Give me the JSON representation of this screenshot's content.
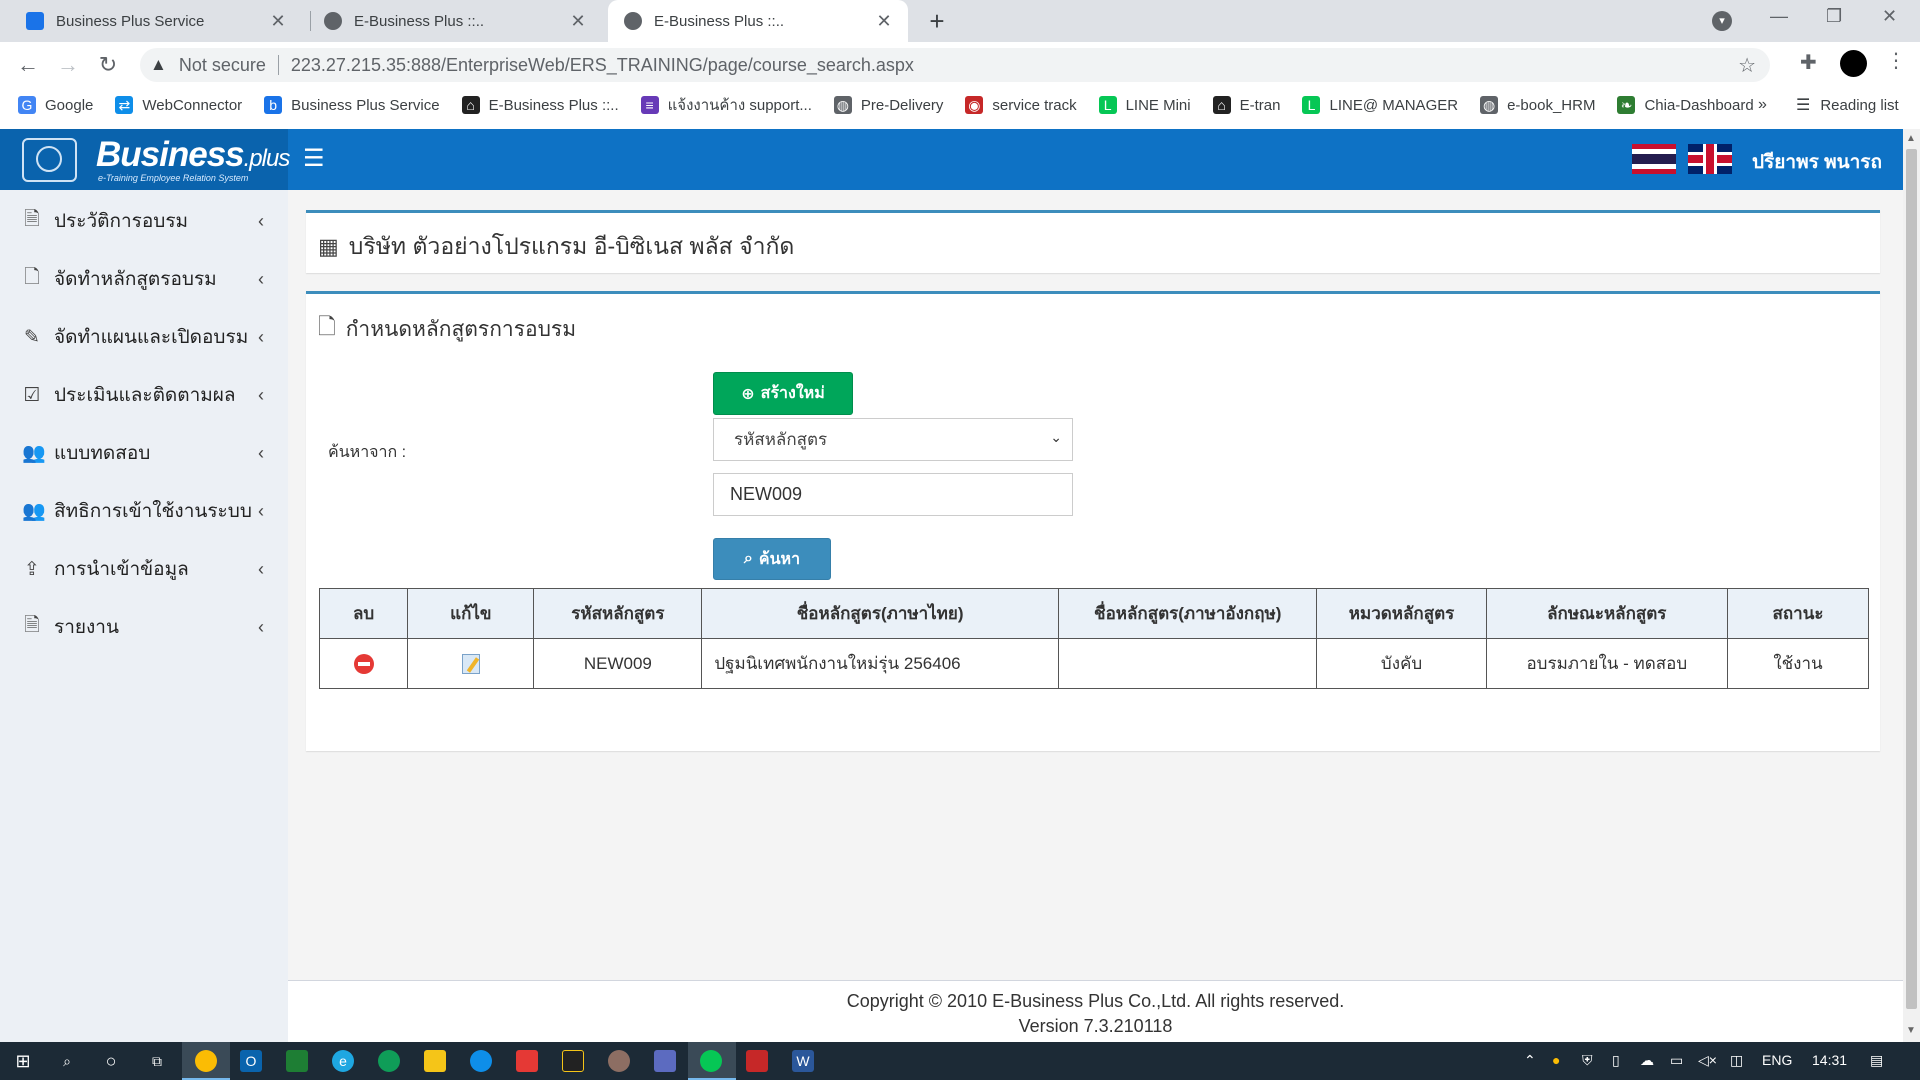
{
  "browser": {
    "tabs": [
      {
        "title": "Business Plus Service",
        "active": false
      },
      {
        "title": "E-Business Plus ::..",
        "active": false
      },
      {
        "title": "E-Business Plus ::..",
        "active": true
      }
    ],
    "security_label": "Not secure",
    "url": "223.27.215.35:888/EnterpriseWeb/ERS_TRAINING/page/course_search.aspx",
    "bookmarks": [
      {
        "label": "Google",
        "icon": "google-icon",
        "color": "#4285f4"
      },
      {
        "label": "WebConnector",
        "icon": "teamviewer-icon",
        "color": "#0e8ee9"
      },
      {
        "label": "Business Plus Service",
        "icon": "bplus-icon",
        "color": "#1a73e8"
      },
      {
        "label": "E-Business Plus ::..",
        "icon": "home-icon",
        "color": "#222222"
      },
      {
        "label": "แจ้งงานค้าง support...",
        "icon": "list-icon",
        "color": "#673ab7"
      },
      {
        "label": "Pre-Delivery",
        "icon": "globe-icon",
        "color": "#5f6368"
      },
      {
        "label": "service track",
        "icon": "track-icon",
        "color": "#c62828"
      },
      {
        "label": "LINE Mini",
        "icon": "line-icon",
        "color": "#06c755"
      },
      {
        "label": "E-tran",
        "icon": "home-icon",
        "color": "#222222"
      },
      {
        "label": "LINE@ MANAGER",
        "icon": "line-icon",
        "color": "#06c755"
      },
      {
        "label": "e-book_HRM",
        "icon": "globe-icon",
        "color": "#5f6368"
      },
      {
        "label": "Chia-Dashboard",
        "icon": "leaf-icon",
        "color": "#2e7d32"
      }
    ],
    "more_bookmarks": "»",
    "reading_list": "Reading list"
  },
  "app": {
    "logo_text": "Business",
    "logo_suffix": ".plus",
    "logo_sub": "e-Training Employee Relation System",
    "user_name": "ปรียาพร พนารถ"
  },
  "sidebar": {
    "items": [
      {
        "label": "ประวัติการอบรม",
        "icon": "document-icon"
      },
      {
        "label": "จัดทำหลักสูตรอบรม",
        "icon": "file-lock-icon"
      },
      {
        "label": "จัดทำแผนและเปิดอบรม",
        "icon": "edit-icon"
      },
      {
        "label": "ประเมินและติดตามผล",
        "icon": "checkbox-icon"
      },
      {
        "label": "แบบทดสอบ",
        "icon": "users-icon"
      },
      {
        "label": "สิทธิการเข้าใช้งานระบบ",
        "icon": "users-icon"
      },
      {
        "label": "การนำเข้าข้อมูล",
        "icon": "upload-icon"
      },
      {
        "label": "รายงาน",
        "icon": "pdf-icon"
      }
    ]
  },
  "company": {
    "title": "บริษัท ตัวอย่างโปรแกรม อี-บิซิเนส พลัส จำกัด"
  },
  "course_panel": {
    "title": "กำหนดหลักสูตรการอบรม",
    "new_button": "สร้างใหม่",
    "search_label": "ค้นหาจาก :",
    "search_by": "รหัสหลักสูตร",
    "search_value": "NEW009",
    "search_button": "ค้นหา"
  },
  "table": {
    "headers": [
      "ลบ",
      "แก้ไข",
      "รหัสหลักสูตร",
      "ชื่อหลักสูตร(ภาษาไทย)",
      "ชื่อหลักสูตร(ภาษาอังกฤษ)",
      "หมวดหลักสูตร",
      "ลักษณะหลักสูตร",
      "สถานะ"
    ],
    "rows": [
      {
        "code": "NEW009",
        "name_th": "ปฐมนิเทศพนักงานใหม่รุ่น 256406",
        "name_en": "",
        "category": "บังคับ",
        "type": "อบรมภายใน - ทดสอบ",
        "status": "ใช้งาน"
      }
    ]
  },
  "footer": {
    "copyright": "Copyright © 2010 E-Business Plus Co.,Ltd. All rights reserved.",
    "version": "Version 7.3.210118"
  },
  "taskbar": {
    "language": "ENG",
    "time": "14:31"
  },
  "colors": {
    "header": "#0e72c5",
    "success": "#00a65a",
    "primary": "#3c8dbc"
  }
}
